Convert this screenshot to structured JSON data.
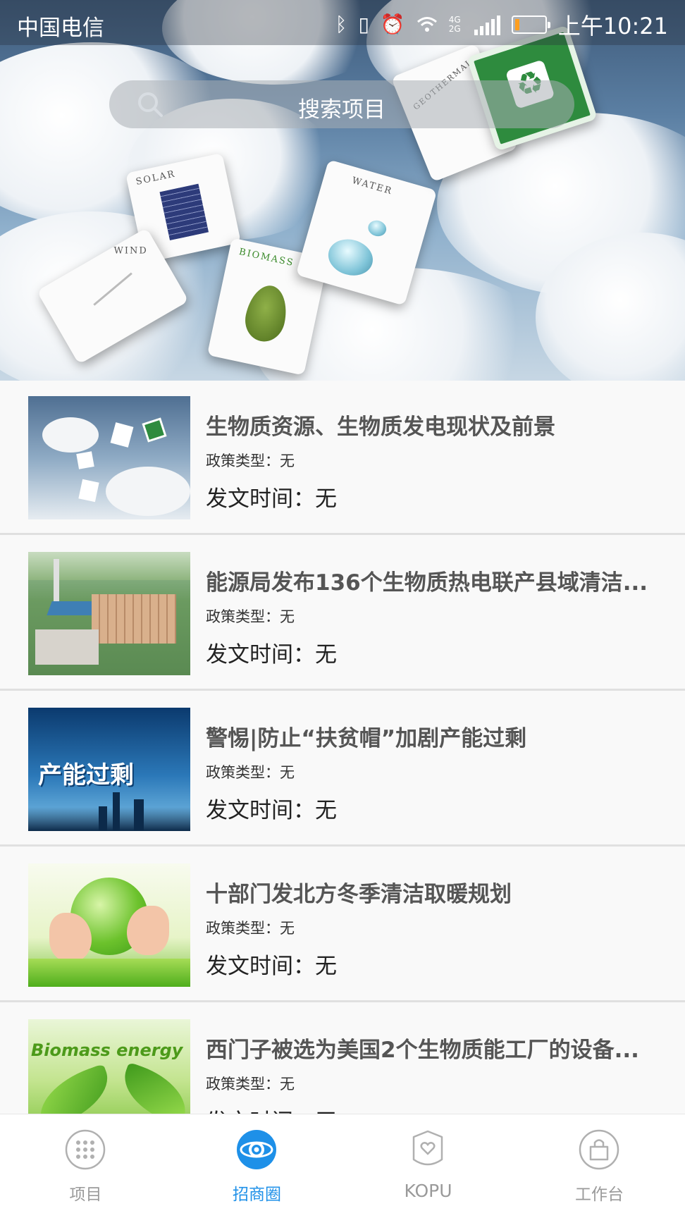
{
  "status_bar": {
    "carrier": "中国电信",
    "network": "4G 2G",
    "battery_level": 0.15,
    "time": "上午10:21",
    "icons": [
      "bluetooth-icon",
      "vibrate-icon",
      "alarm-icon",
      "wifi-icon",
      "signal-icon",
      "battery-icon"
    ]
  },
  "search": {
    "placeholder": "搜索项目",
    "icon": "search-icon"
  },
  "banner": {
    "cards": {
      "solar": "SOLAR",
      "wind": "WIND",
      "biomass": "BIOMASS",
      "water": "WATER",
      "geothermal": "GEOTHERMAL"
    }
  },
  "list": {
    "items": [
      {
        "title": "生物质资源、生物质发电现状及前景",
        "policy": "政策类型：无",
        "date": "发文时间：无",
        "thumb": "clean-energy-cards"
      },
      {
        "title": "能源局发布136个生物质热电联产县域清洁...",
        "policy": "政策类型：无",
        "date": "发文时间：无",
        "thumb": "power-plant"
      },
      {
        "title": "警惕|防止“扶贫帽”加剧产能过剩",
        "policy": "政策类型：无",
        "date": "发文时间：无",
        "thumb": "overcapacity",
        "thumb_text": "产能过剩"
      },
      {
        "title": "十部门发北方冬季清洁取暖规划",
        "policy": "政策类型：无",
        "date": "发文时间：无",
        "thumb": "hands-globe"
      },
      {
        "title": "西门子被选为美国2个生物质能工厂的设备...",
        "policy": "政策类型：无",
        "date": "发文时间：无",
        "thumb": "biomass-energy",
        "thumb_text": "Biomass energy"
      }
    ]
  },
  "tabbar": {
    "accent": "#1e90e8",
    "inactive": "#9a9a9a",
    "tabs": [
      {
        "label": "项目",
        "icon": "grid-dots-icon",
        "active": false
      },
      {
        "label": "招商圈",
        "icon": "circle-target-icon",
        "active": true
      },
      {
        "label": "KOPU",
        "icon": "shield-heart-icon",
        "active": false
      },
      {
        "label": "工作台",
        "icon": "bag-icon",
        "active": false
      }
    ]
  }
}
